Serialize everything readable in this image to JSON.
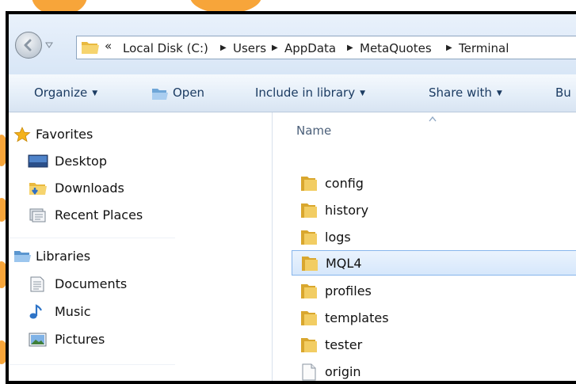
{
  "address": {
    "overflow_chevron": "«",
    "crumbs": [
      "Local Disk (C:)",
      "Users",
      "AppData",
      "MetaQuotes",
      "Terminal"
    ]
  },
  "toolbar": {
    "organize": "Organize",
    "open": "Open",
    "include_in_library": "Include in library",
    "share_with": "Share with",
    "burn": "Bu"
  },
  "nav": {
    "favorites": {
      "label": "Favorites",
      "items": [
        {
          "label": "Desktop",
          "icon": "desktop-icon"
        },
        {
          "label": "Downloads",
          "icon": "downloads-folder-icon"
        },
        {
          "label": "Recent Places",
          "icon": "recent-places-icon"
        }
      ]
    },
    "libraries": {
      "label": "Libraries",
      "items": [
        {
          "label": "Documents",
          "icon": "documents-icon"
        },
        {
          "label": "Music",
          "icon": "music-note-icon"
        },
        {
          "label": "Pictures",
          "icon": "pictures-icon"
        }
      ]
    }
  },
  "content": {
    "column_name": "Name",
    "files": [
      {
        "name": "config",
        "type": "folder"
      },
      {
        "name": "history",
        "type": "folder"
      },
      {
        "name": "logs",
        "type": "folder"
      },
      {
        "name": "MQL4",
        "type": "folder",
        "selected": true
      },
      {
        "name": "profiles",
        "type": "folder"
      },
      {
        "name": "templates",
        "type": "folder"
      },
      {
        "name": "tester",
        "type": "folder"
      },
      {
        "name": "origin",
        "type": "file"
      }
    ]
  },
  "colors": {
    "accent_orange": "#f7a53a",
    "selection_border": "#86b5ec",
    "toolbar_text": "#1b3b62"
  }
}
